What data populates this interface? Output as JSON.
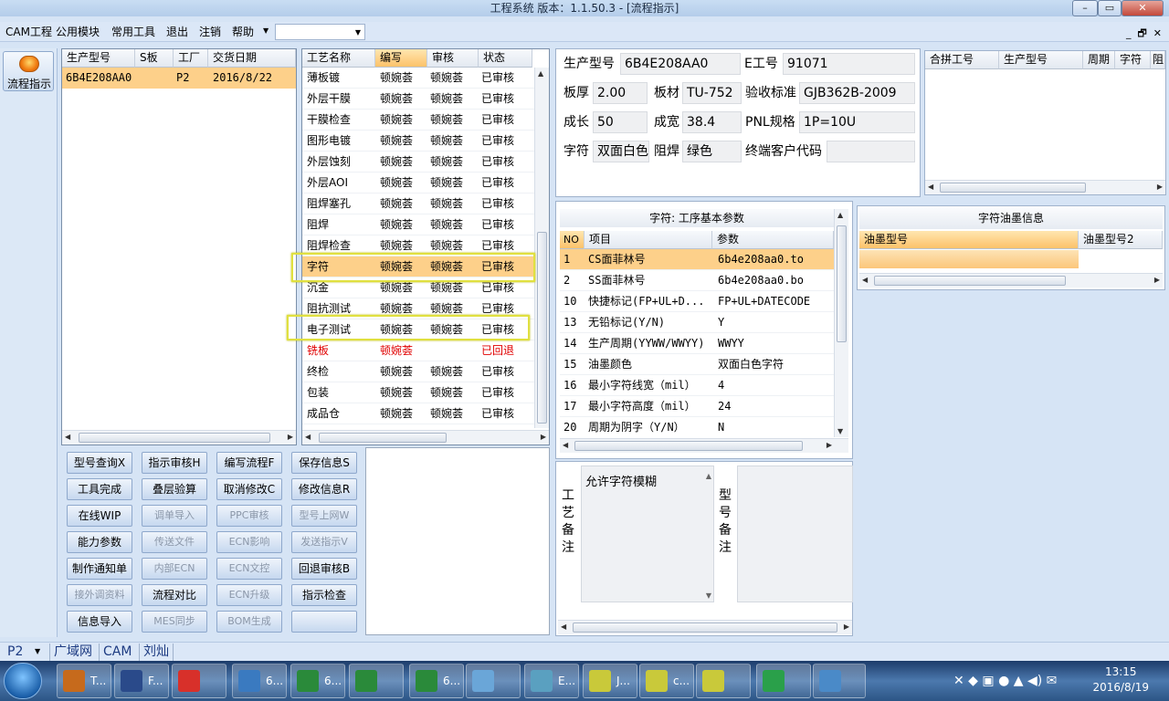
{
  "window": {
    "title": "工程系统    版本：1.1.50.3 - [流程指示]",
    "min_icon": "minimize-icon",
    "max_icon": "maximize-icon",
    "close_icon": "close-icon"
  },
  "menu": {
    "items": [
      "CAM工程",
      "公用模块",
      "常用工具",
      "退出",
      "注销",
      "帮助"
    ],
    "combo_value": ""
  },
  "nav": {
    "label": "流程指示"
  },
  "orders": {
    "columns": [
      "生产型号",
      "S板",
      "工厂",
      "交货日期"
    ],
    "rows": [
      {
        "model": "6B4E208AA0",
        "s": "",
        "factory": "P2",
        "date": "2016/8/22"
      }
    ]
  },
  "process": {
    "columns": [
      "工艺名称",
      "编写",
      "审核",
      "状态"
    ],
    "rows": [
      {
        "name": "薄板镀",
        "writer": "顿婉荟",
        "reviewer": "顿婉荟",
        "status": "已审核"
      },
      {
        "name": "外层干膜",
        "writer": "顿婉荟",
        "reviewer": "顿婉荟",
        "status": "已审核"
      },
      {
        "name": "干膜检查",
        "writer": "顿婉荟",
        "reviewer": "顿婉荟",
        "status": "已审核"
      },
      {
        "name": "图形电镀",
        "writer": "顿婉荟",
        "reviewer": "顿婉荟",
        "status": "已审核"
      },
      {
        "name": "外层蚀刻",
        "writer": "顿婉荟",
        "reviewer": "顿婉荟",
        "status": "已审核"
      },
      {
        "name": "外层AOI",
        "writer": "顿婉荟",
        "reviewer": "顿婉荟",
        "status": "已审核"
      },
      {
        "name": "阻焊塞孔",
        "writer": "顿婉荟",
        "reviewer": "顿婉荟",
        "status": "已审核"
      },
      {
        "name": "阻焊",
        "writer": "顿婉荟",
        "reviewer": "顿婉荟",
        "status": "已审核"
      },
      {
        "name": "阻焊检查",
        "writer": "顿婉荟",
        "reviewer": "顿婉荟",
        "status": "已审核"
      },
      {
        "name": "字符",
        "writer": "顿婉荟",
        "reviewer": "顿婉荟",
        "status": "已审核"
      },
      {
        "name": "沉金",
        "writer": "顿婉荟",
        "reviewer": "顿婉荟",
        "status": "已审核"
      },
      {
        "name": "阻抗测试",
        "writer": "顿婉荟",
        "reviewer": "顿婉荟",
        "status": "已审核"
      },
      {
        "name": "电子测试",
        "writer": "顿婉荟",
        "reviewer": "顿婉荟",
        "status": "已审核"
      },
      {
        "name": "铣板",
        "writer": "顿婉荟",
        "reviewer": "",
        "status": "已回退"
      },
      {
        "name": "终检",
        "writer": "顿婉荟",
        "reviewer": "顿婉荟",
        "status": "已审核"
      },
      {
        "name": "包装",
        "writer": "顿婉荟",
        "reviewer": "顿婉荟",
        "status": "已审核"
      },
      {
        "name": "成品仓",
        "writer": "顿婉荟",
        "reviewer": "顿婉荟",
        "status": "已审核"
      }
    ]
  },
  "info": {
    "labels": {
      "model": "生产型号",
      "eno": "E工号",
      "thickness": "板厚",
      "material": "板材",
      "standard": "验收标准",
      "length": "成长",
      "width": "成宽",
      "pnl": "PNL规格",
      "char": "字符",
      "mask": "阻焊",
      "customer": "终端客户代码"
    },
    "values": {
      "model": "6B4E208AA0",
      "eno": "91071",
      "thickness": "2.00",
      "material": "TU-752",
      "standard": "GJB362B-2009",
      "length": "50",
      "width": "38.4",
      "pnl": "1P=10U",
      "char": "双面白色",
      "mask": "绿色",
      "customer": ""
    }
  },
  "merge": {
    "columns": [
      "合拼工号",
      "生产型号",
      "周期",
      "字符",
      "阻"
    ]
  },
  "params": {
    "title": "字符: 工序基本参数",
    "columns": [
      "NO",
      "项目",
      "参数"
    ],
    "rows": [
      {
        "no": "1",
        "item": "CS面菲林号",
        "value": "6b4e208aa0.to"
      },
      {
        "no": "2",
        "item": "SS面菲林号",
        "value": "6b4e208aa0.bo"
      },
      {
        "no": "10",
        "item": "快捷标记(FP+UL+D...",
        "value": "FP+UL+DATECODE"
      },
      {
        "no": "13",
        "item": "无铅标记(Y/N)",
        "value": "Y"
      },
      {
        "no": "14",
        "item": "生产周期(YYWW/WWYY)",
        "value": "WWYY"
      },
      {
        "no": "15",
        "item": "油墨颜色",
        "value": "双面白色字符"
      },
      {
        "no": "16",
        "item": "最小字符线宽（mil）",
        "value": "4"
      },
      {
        "no": "17",
        "item": "最小字符高度（mil）",
        "value": "24"
      },
      {
        "no": "20",
        "item": "周期为阴字（Y/N）",
        "value": "N"
      }
    ]
  },
  "ink": {
    "title": "字符油墨信息",
    "columns": [
      "油墨型号",
      "油墨型号2"
    ]
  },
  "remarks": {
    "process_label": "工艺备注",
    "process_text": "允许字符模糊",
    "model_label": "型号备注",
    "model_text": ""
  },
  "buttons": [
    [
      "型号查询X",
      "指示审核H",
      "编写流程F",
      "保存信息S"
    ],
    [
      "工具完成",
      "叠层验算",
      "取消修改C",
      "修改信息R"
    ],
    [
      "在线WIP",
      "调单导入",
      "PPC审核",
      "型号上网W"
    ],
    [
      "能力参数",
      "传送文件",
      "ECN影响",
      "发送指示V"
    ],
    [
      "制作通知单",
      "内部ECN",
      "ECN文控",
      "回退审核B"
    ],
    [
      "接外调资料",
      "流程对比",
      "ECN升级",
      "指示检查"
    ],
    [
      "信息导入",
      "MES同步",
      "BOM生成",
      ""
    ]
  ],
  "disabled_buttons": [
    "调单导入",
    "PPC审核",
    "型号上网W",
    "传送文件",
    "ECN影响",
    "发送指示V",
    "内部ECN",
    "ECN文控",
    "接外调资料",
    "ECN升级",
    "MES同步",
    "BOM生成"
  ],
  "status": {
    "plant": "P2",
    "network": "广域网",
    "module": "CAM",
    "user": "刘灿"
  },
  "taskbar": {
    "items": [
      "T...",
      "F...",
      "",
      "6...",
      "6...",
      "",
      "6...",
      "",
      "E...",
      "J...",
      "c...",
      "",
      "",
      ""
    ],
    "time": "13:15",
    "date": "2016/8/19"
  },
  "colors": {
    "selected_row": "#fdd08a",
    "rollback": "#e00000",
    "highlight_box": "#e0e040"
  }
}
